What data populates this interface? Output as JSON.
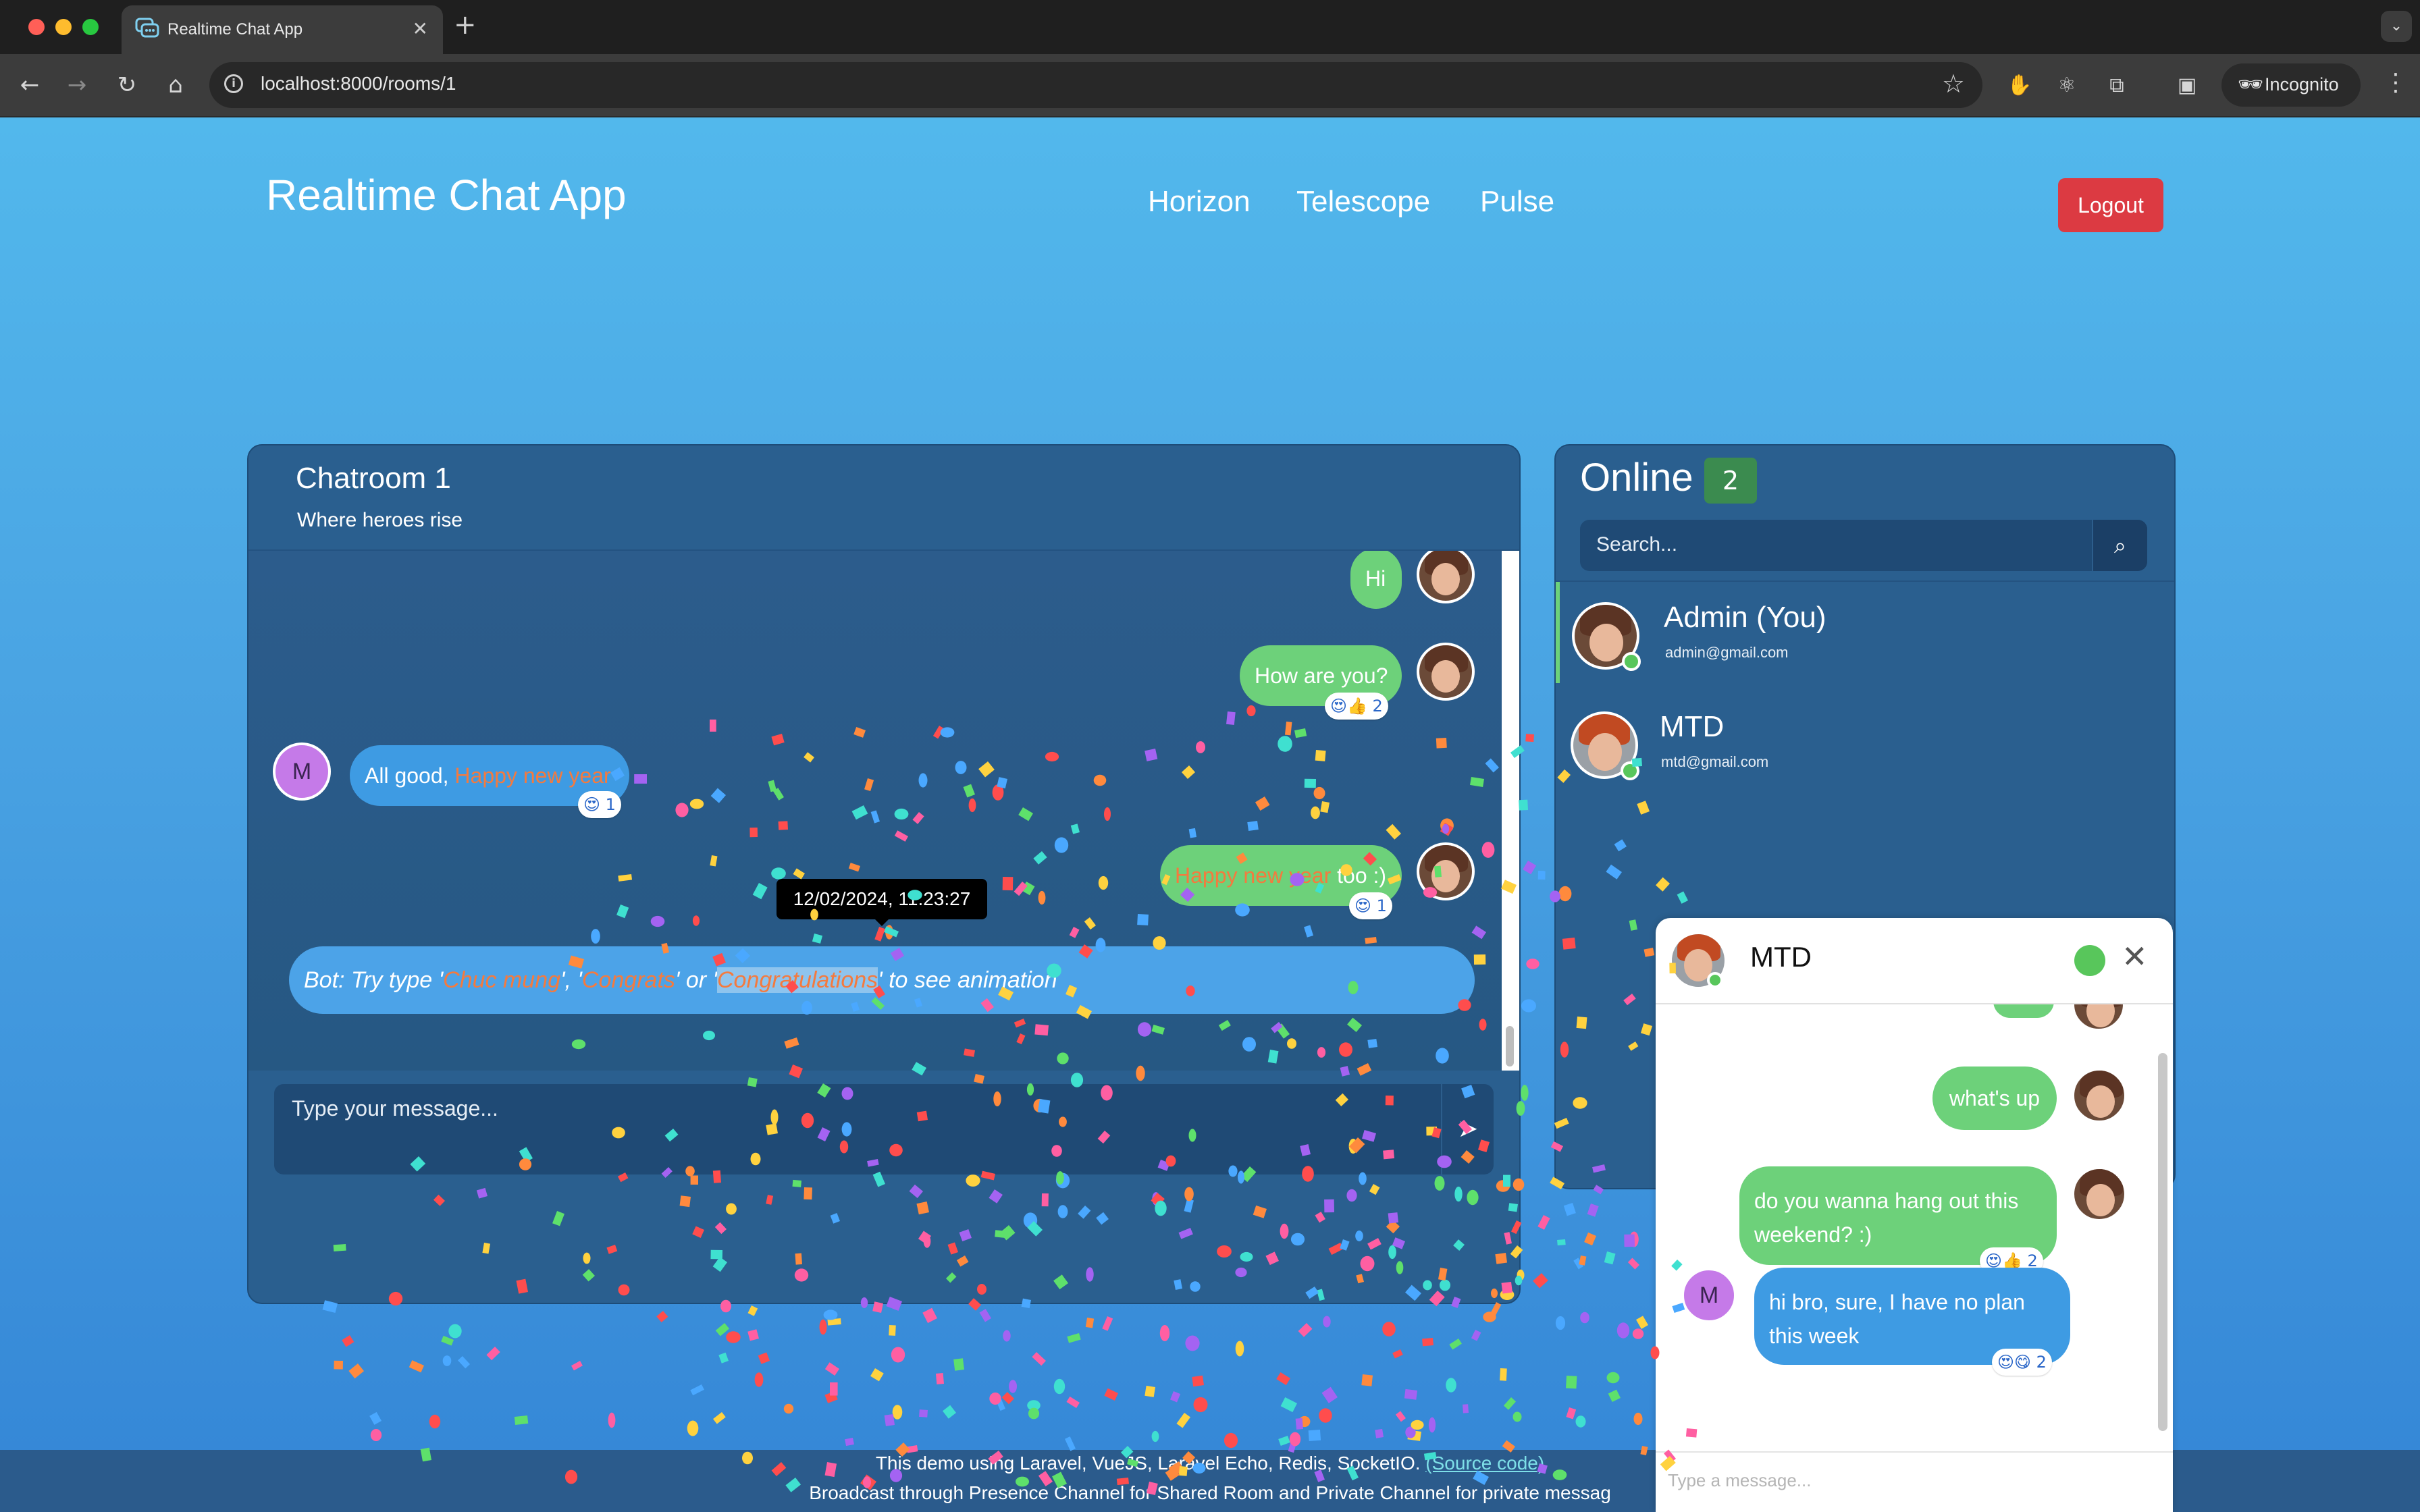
{
  "browser": {
    "tab_title": "Realtime Chat App",
    "url": "localhost:8000/rooms/1",
    "profile_label": "Incognito"
  },
  "header": {
    "title": "Realtime Chat App",
    "nav": [
      "Horizon",
      "Telescope",
      "Pulse"
    ],
    "logout_label": "Logout"
  },
  "chatroom": {
    "title": "Chatroom 1",
    "subtitle": "Where heroes rise",
    "messages": [
      {
        "text": "Hi",
        "side": "right"
      },
      {
        "text": "How are you?",
        "side": "right",
        "reactions": "😍👍 2"
      },
      {
        "prefix": "All good, ",
        "highlight": "Happy new year",
        "side": "left",
        "avatar": "M",
        "reactions": "😍 1"
      },
      {
        "highlight": "Happy new year",
        "suffix": " too :)",
        "side": "right",
        "reactions": "😍 1"
      }
    ],
    "bot_message": {
      "lead": "Bot: Try type '",
      "word1": "Chuc mung",
      "sep1": "', '",
      "word2": "Congrats",
      "sep2": "' or '",
      "word3": "Congratulations",
      "tail": "' to see animation"
    },
    "tooltip": "12/02/2024, 11:23:27",
    "compose_placeholder": "Type your message..."
  },
  "online": {
    "title": "Online",
    "count": "2",
    "search_placeholder": "Search...",
    "users": [
      {
        "name": "Admin (You)",
        "email": "admin@gmail.com"
      },
      {
        "name": "MTD",
        "email": "mtd@gmail.com"
      }
    ]
  },
  "private_chat": {
    "name": "MTD",
    "messages": [
      {
        "text": "what's up",
        "side": "right"
      },
      {
        "line1": "do you wanna hang out this",
        "line2": "weekend? :)",
        "side": "right",
        "reactions": "😍👍 2"
      },
      {
        "line1": "hi bro, sure, I have no plan",
        "line2": "this week",
        "side": "left",
        "avatar": "M",
        "reactions": "😍😋 2"
      }
    ],
    "input_placeholder": "Type a message..."
  },
  "footer": {
    "line1_text": "This demo using Laravel, VueJS, Laravel Echo, Redis, SocketIO. ",
    "line1_link": "(Source code)",
    "line2_text": "Broadcast through Presence Channel for Shared Room and Private Channel for private messag"
  },
  "colors": {
    "sent_bubble": "#6dd17a",
    "received_bubble": "#3e9be3",
    "highlight_text": "#f47a3e",
    "logout": "#dc3a42",
    "online_dot": "#58c65b"
  }
}
